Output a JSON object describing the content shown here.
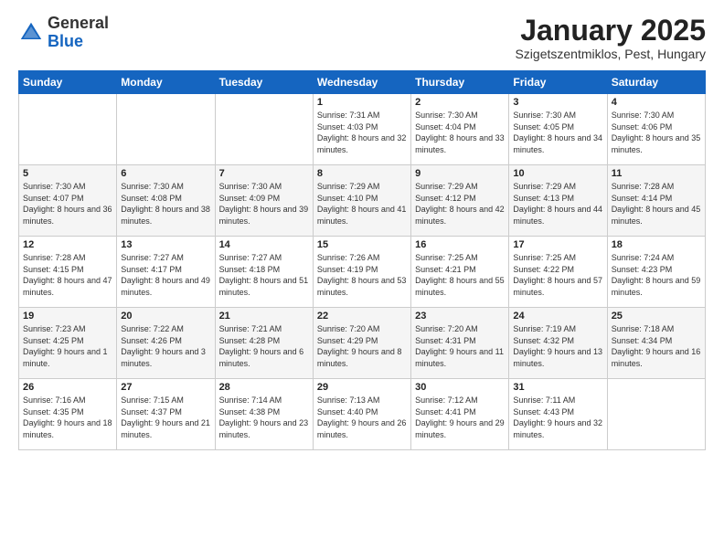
{
  "header": {
    "logo_general": "General",
    "logo_blue": "Blue",
    "title": "January 2025",
    "location": "Szigetszentmiklos, Pest, Hungary"
  },
  "weekdays": [
    "Sunday",
    "Monday",
    "Tuesday",
    "Wednesday",
    "Thursday",
    "Friday",
    "Saturday"
  ],
  "weeks": [
    [
      {
        "day": "",
        "text": ""
      },
      {
        "day": "",
        "text": ""
      },
      {
        "day": "",
        "text": ""
      },
      {
        "day": "1",
        "text": "Sunrise: 7:31 AM\nSunset: 4:03 PM\nDaylight: 8 hours and 32 minutes."
      },
      {
        "day": "2",
        "text": "Sunrise: 7:30 AM\nSunset: 4:04 PM\nDaylight: 8 hours and 33 minutes."
      },
      {
        "day": "3",
        "text": "Sunrise: 7:30 AM\nSunset: 4:05 PM\nDaylight: 8 hours and 34 minutes."
      },
      {
        "day": "4",
        "text": "Sunrise: 7:30 AM\nSunset: 4:06 PM\nDaylight: 8 hours and 35 minutes."
      }
    ],
    [
      {
        "day": "5",
        "text": "Sunrise: 7:30 AM\nSunset: 4:07 PM\nDaylight: 8 hours and 36 minutes."
      },
      {
        "day": "6",
        "text": "Sunrise: 7:30 AM\nSunset: 4:08 PM\nDaylight: 8 hours and 38 minutes."
      },
      {
        "day": "7",
        "text": "Sunrise: 7:30 AM\nSunset: 4:09 PM\nDaylight: 8 hours and 39 minutes."
      },
      {
        "day": "8",
        "text": "Sunrise: 7:29 AM\nSunset: 4:10 PM\nDaylight: 8 hours and 41 minutes."
      },
      {
        "day": "9",
        "text": "Sunrise: 7:29 AM\nSunset: 4:12 PM\nDaylight: 8 hours and 42 minutes."
      },
      {
        "day": "10",
        "text": "Sunrise: 7:29 AM\nSunset: 4:13 PM\nDaylight: 8 hours and 44 minutes."
      },
      {
        "day": "11",
        "text": "Sunrise: 7:28 AM\nSunset: 4:14 PM\nDaylight: 8 hours and 45 minutes."
      }
    ],
    [
      {
        "day": "12",
        "text": "Sunrise: 7:28 AM\nSunset: 4:15 PM\nDaylight: 8 hours and 47 minutes."
      },
      {
        "day": "13",
        "text": "Sunrise: 7:27 AM\nSunset: 4:17 PM\nDaylight: 8 hours and 49 minutes."
      },
      {
        "day": "14",
        "text": "Sunrise: 7:27 AM\nSunset: 4:18 PM\nDaylight: 8 hours and 51 minutes."
      },
      {
        "day": "15",
        "text": "Sunrise: 7:26 AM\nSunset: 4:19 PM\nDaylight: 8 hours and 53 minutes."
      },
      {
        "day": "16",
        "text": "Sunrise: 7:25 AM\nSunset: 4:21 PM\nDaylight: 8 hours and 55 minutes."
      },
      {
        "day": "17",
        "text": "Sunrise: 7:25 AM\nSunset: 4:22 PM\nDaylight: 8 hours and 57 minutes."
      },
      {
        "day": "18",
        "text": "Sunrise: 7:24 AM\nSunset: 4:23 PM\nDaylight: 8 hours and 59 minutes."
      }
    ],
    [
      {
        "day": "19",
        "text": "Sunrise: 7:23 AM\nSunset: 4:25 PM\nDaylight: 9 hours and 1 minute."
      },
      {
        "day": "20",
        "text": "Sunrise: 7:22 AM\nSunset: 4:26 PM\nDaylight: 9 hours and 3 minutes."
      },
      {
        "day": "21",
        "text": "Sunrise: 7:21 AM\nSunset: 4:28 PM\nDaylight: 9 hours and 6 minutes."
      },
      {
        "day": "22",
        "text": "Sunrise: 7:20 AM\nSunset: 4:29 PM\nDaylight: 9 hours and 8 minutes."
      },
      {
        "day": "23",
        "text": "Sunrise: 7:20 AM\nSunset: 4:31 PM\nDaylight: 9 hours and 11 minutes."
      },
      {
        "day": "24",
        "text": "Sunrise: 7:19 AM\nSunset: 4:32 PM\nDaylight: 9 hours and 13 minutes."
      },
      {
        "day": "25",
        "text": "Sunrise: 7:18 AM\nSunset: 4:34 PM\nDaylight: 9 hours and 16 minutes."
      }
    ],
    [
      {
        "day": "26",
        "text": "Sunrise: 7:16 AM\nSunset: 4:35 PM\nDaylight: 9 hours and 18 minutes."
      },
      {
        "day": "27",
        "text": "Sunrise: 7:15 AM\nSunset: 4:37 PM\nDaylight: 9 hours and 21 minutes."
      },
      {
        "day": "28",
        "text": "Sunrise: 7:14 AM\nSunset: 4:38 PM\nDaylight: 9 hours and 23 minutes."
      },
      {
        "day": "29",
        "text": "Sunrise: 7:13 AM\nSunset: 4:40 PM\nDaylight: 9 hours and 26 minutes."
      },
      {
        "day": "30",
        "text": "Sunrise: 7:12 AM\nSunset: 4:41 PM\nDaylight: 9 hours and 29 minutes."
      },
      {
        "day": "31",
        "text": "Sunrise: 7:11 AM\nSunset: 4:43 PM\nDaylight: 9 hours and 32 minutes."
      },
      {
        "day": "",
        "text": ""
      }
    ]
  ]
}
